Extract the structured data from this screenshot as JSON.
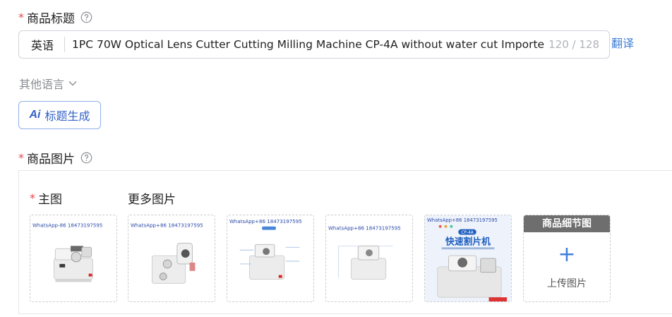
{
  "title_field": {
    "label": "商品标题",
    "language": "英语",
    "value": "1PC 70W Optical Lens Cutter Cutting Milling Machine CP-4A without water cut Importe",
    "counter": "120 / 128",
    "translate_label": "翻译"
  },
  "other_languages_label": "其他语言",
  "ai_button": {
    "badge": "Ai",
    "label": "标题生成"
  },
  "images_field": {
    "label": "商品图片",
    "main_label": "主图",
    "more_label": "更多图片",
    "thumb_caption": "WhatsApp+86 18473197595",
    "thumb_caption_first": "WhatsApp-86 18473197595",
    "promo_title": "快速割片机",
    "promo_model": "CP-4A",
    "detail_header": "商品细节图",
    "upload_label": "上传图片"
  },
  "colors": {
    "required": "#e5484d",
    "link": "#3d7ed9",
    "ai_accent": "#3461c9",
    "promo_blue": "#1f5fbf"
  }
}
